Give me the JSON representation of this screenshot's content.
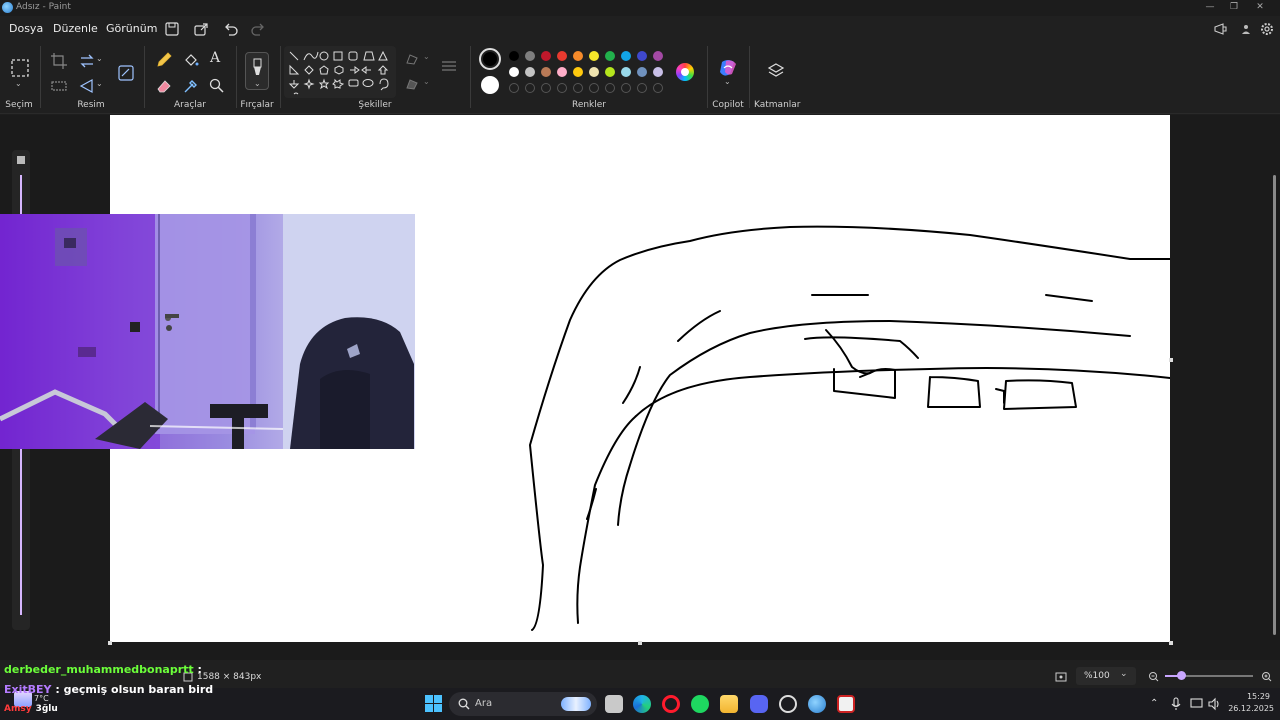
{
  "window": {
    "title": "Adsız - Paint"
  },
  "menu": {
    "file": "Dosya",
    "edit": "Düzenle",
    "view": "Görünüm"
  },
  "ribbon": {
    "groups": {
      "selection": "Seçim",
      "image": "Resim",
      "tools": "Araçlar",
      "brushes": "Fırçalar",
      "shapes": "Şekiller",
      "colors": "Renkler",
      "copilot": "Copilot",
      "layers": "Katmanlar"
    },
    "text_tool": "A",
    "palette_row1": [
      "#000000",
      "#7f7f7f",
      "#c0182b",
      "#e83a2f",
      "#f58a2a",
      "#f5e62a",
      "#22b14c",
      "#12a4e6",
      "#3f48cc",
      "#a349a4"
    ],
    "palette_row2": [
      "#ffffff",
      "#c3c3c3",
      "#b97a57",
      "#ffaec9",
      "#ffc90e",
      "#efe4b0",
      "#b5e61d",
      "#99d9ea",
      "#7092be",
      "#c8bfe7"
    ],
    "primary_color": "#000000",
    "secondary_color": "#ffffff"
  },
  "status": {
    "canvas_size": "1588 × 843px",
    "zoom": "%100"
  },
  "chat": {
    "line1_user": "derbeder_muhammedbonaprtt",
    "line1_sep": " :",
    "line2_user": "ExitBEY",
    "line2_sep": " : ",
    "line2_msg": "geçmiş olsun baran bird",
    "line3_user": "Amsy",
    "line3_msg": "3ğlu"
  },
  "weather": {
    "temp": "7°C"
  },
  "taskbar": {
    "search": "Ara",
    "time": "15:29",
    "date": "26.12.2025"
  }
}
